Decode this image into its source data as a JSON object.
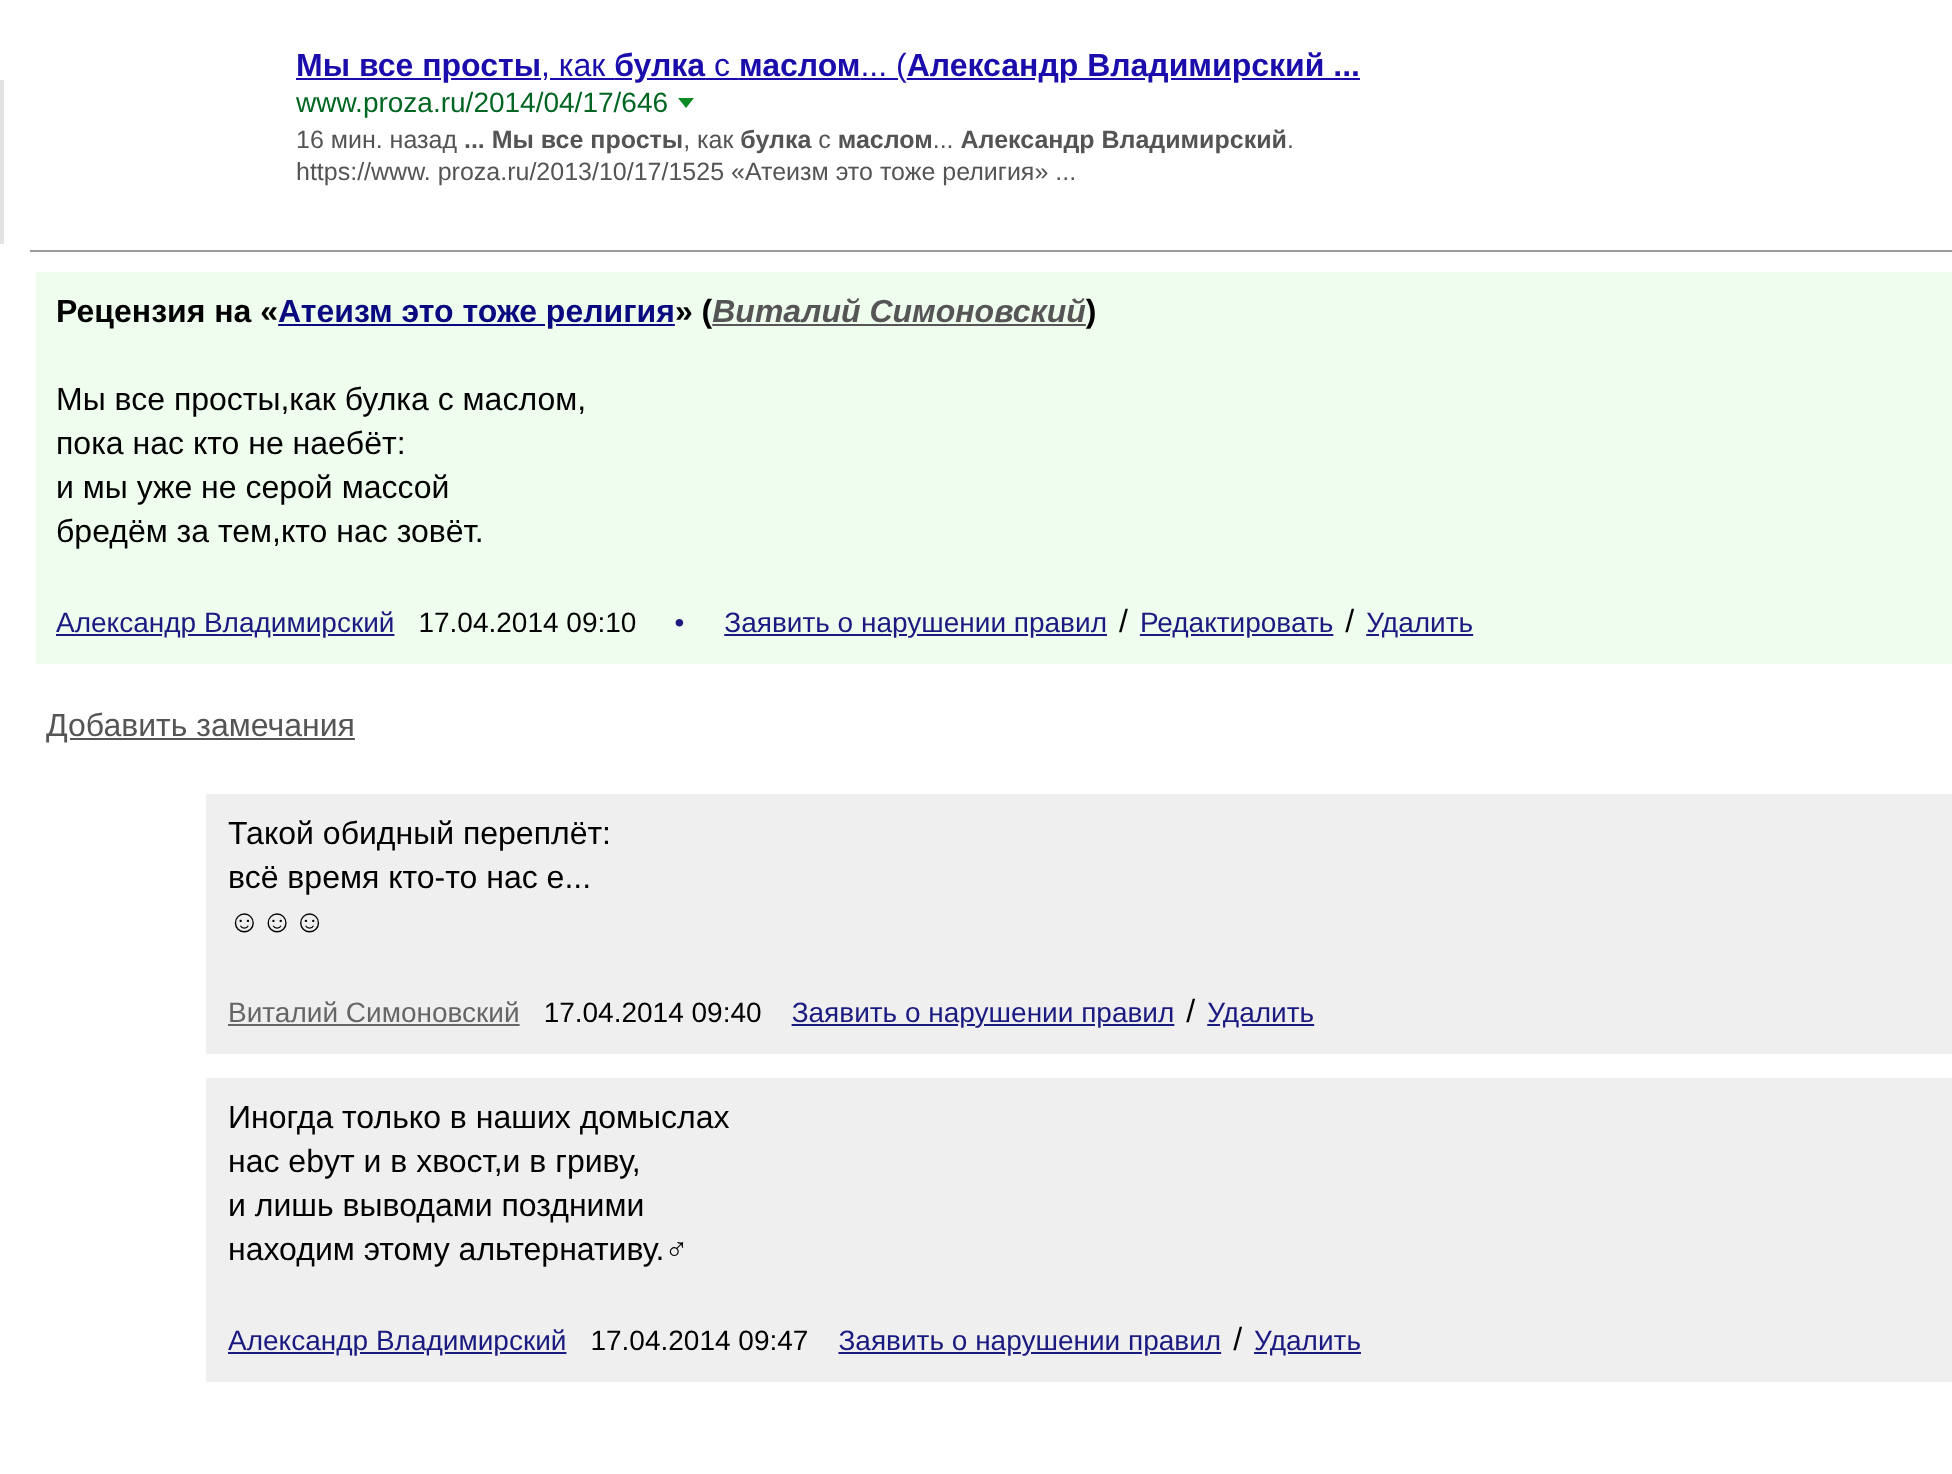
{
  "search_result": {
    "title": "**Мы все просты**, как **булка** с **маслом**... (**Александр Владимирский ...**",
    "url": "www.proza.ru/2014/04/17/646",
    "snippet_lines": [
      "16 мин. назад **... Мы все просты**, как **булка** с **маслом**... **Александр Владимирский**.",
      "https://www. proza.ru/2013/10/17/1525 «Атеизм это тоже религия» ..."
    ]
  },
  "review": {
    "heading_prefix": "Рецензия на «",
    "work_link": "Атеизм это тоже религия",
    "heading_middle": "» (",
    "author_link": "Виталий Симоновский",
    "heading_suffix": ")",
    "poem_lines": [
      "Мы все просты,как булка с маслом,",
      "пока нас кто не наeбёт:",
      "и мы уже не серой массой",
      "бредём за тем,кто нас зовёт."
    ],
    "author": "Александр Владимирский",
    "author_greyed": false,
    "date": "17.04.2014 09:10",
    "bullet": "•",
    "actions": [
      "Заявить о нарушении правил",
      "Редактировать",
      "Удалить"
    ],
    "separator": "/"
  },
  "add_comment_link": "Добавить замечания",
  "comments": [
    {
      "lines": [
        "Такой обидный переплёт:",
        "всё время кто-то нас е...",
        "☺☺☺"
      ],
      "author": "Виталий Симоновский",
      "author_greyed": true,
      "date": "17.04.2014 09:40",
      "actions": [
        "Заявить о нарушении правил",
        "Удалить"
      ],
      "separator": "/"
    },
    {
      "lines": [
        "Иногда только в наших домыслах",
        "нас ebут и в хвост,и в гриву,",
        "и лишь выводами поздними",
        "находим этому альтернативу.♂"
      ],
      "author": "Александр Владимирский",
      "author_greyed": false,
      "date": "17.04.2014 09:47",
      "actions": [
        "Заявить о нарушении правил",
        "Удалить"
      ],
      "separator": "/"
    }
  ]
}
